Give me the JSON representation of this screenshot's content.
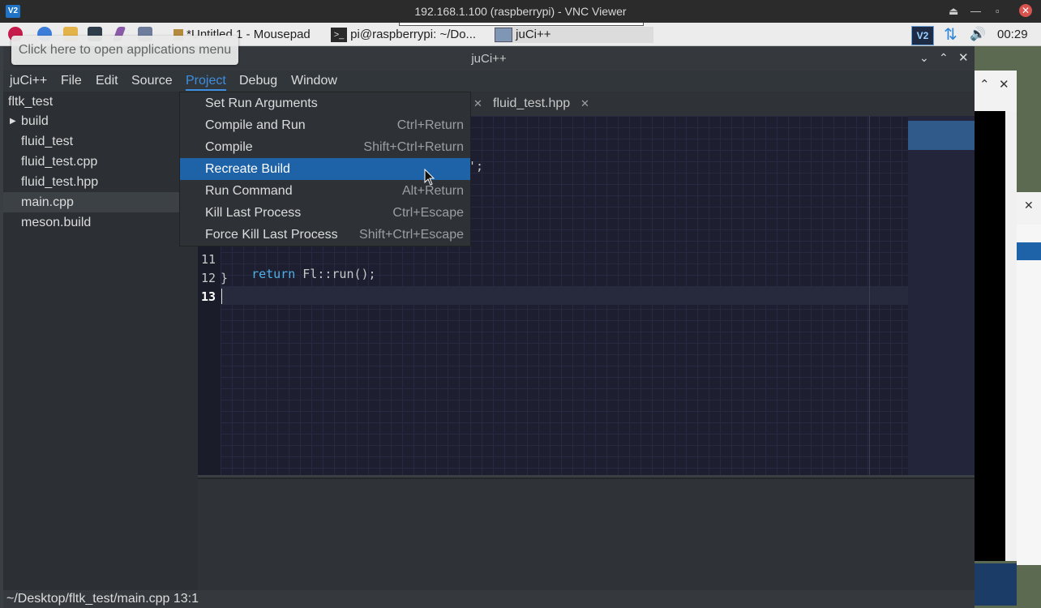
{
  "vnc": {
    "title": "192.168.1.100 (raspberrypi) - VNC Viewer",
    "logo": "V2"
  },
  "taskbar": {
    "tasks": [
      "*Untitled 1 - Mousepad",
      "pi@raspberrypi: ~/Do...",
      "juCi++"
    ],
    "clock": "00:29",
    "tooltip": "Click here to open applications menu"
  },
  "window": {
    "title": "juCi++"
  },
  "menubar": [
    "juCi++",
    "File",
    "Edit",
    "Source",
    "Project",
    "Debug",
    "Window"
  ],
  "sidebar": {
    "root": "fltk_test",
    "items": [
      "build",
      "fluid_test",
      "fluid_test.cpp",
      "fluid_test.hpp",
      "main.cpp",
      "meson.build"
    ]
  },
  "tabs": {
    "visible": "fluid_test.hpp"
  },
  "editor": {
    "fragment": "';",
    "lines": [
      {
        "num": "11",
        "kw": "return",
        "rest": " Fl::run();"
      },
      {
        "num": "12",
        "kw": "",
        "rest": "}"
      },
      {
        "num": "13",
        "kw": "",
        "rest": ""
      }
    ]
  },
  "project_menu": [
    {
      "label": "Set Run Arguments",
      "accel": ""
    },
    {
      "label": "Compile and Run",
      "accel": "Ctrl+Return"
    },
    {
      "label": "Compile",
      "accel": "Shift+Ctrl+Return"
    },
    {
      "label": "Recreate Build",
      "accel": ""
    },
    {
      "label": "Run Command",
      "accel": "Alt+Return"
    },
    {
      "label": "Kill Last Process",
      "accel": "Ctrl+Escape"
    },
    {
      "label": "Force Kill Last Process",
      "accel": "Shift+Ctrl+Escape"
    }
  ],
  "status": {
    "path": "~/Desktop/fltk_test/main.cpp 13:1"
  },
  "colors": {
    "accent": "#1e62a8",
    "keyword": "#4fb0e8",
    "editor_bg": "#1d1f30"
  }
}
